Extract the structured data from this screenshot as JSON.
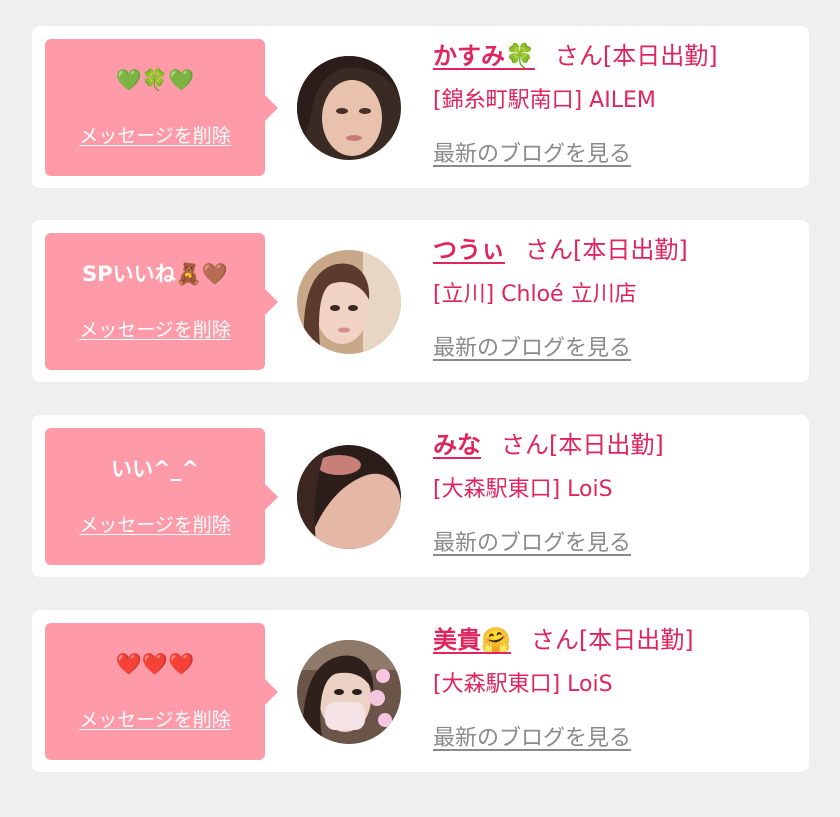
{
  "messages": [
    {
      "bubble_text": "💚🍀💚",
      "delete_label": "メッセージを削除",
      "name": "かすみ🍀",
      "status": "さん[本日出勤]",
      "shop": "[錦糸町駅南口] AILEM",
      "blog_label": "最新のブログを見る"
    },
    {
      "bubble_text": "SPいいね🧸🤎",
      "delete_label": "メッセージを削除",
      "name": "つうぃ",
      "status": "さん[本日出勤]",
      "shop": "[立川] Chloé 立川店",
      "blog_label": "最新のブログを見る"
    },
    {
      "bubble_text": "いい^_^",
      "delete_label": "メッセージを削除",
      "name": "みな",
      "status": "さん[本日出勤]",
      "shop": "[大森駅東口] LoiS",
      "blog_label": "最新のブログを見る"
    },
    {
      "bubble_text": "❤️❤️❤️",
      "delete_label": "メッセージを削除",
      "name": "美貴🤗",
      "status": "さん[本日出勤]",
      "shop": "[大森駅東口] LoiS",
      "blog_label": "最新のブログを見る"
    }
  ],
  "colors": {
    "page_background": "#efefef",
    "card_background": "#ffffff",
    "bubble_pink": "#ff9aa8",
    "name_pink": "#e0245e",
    "link_gray": "#8a8a8a"
  }
}
